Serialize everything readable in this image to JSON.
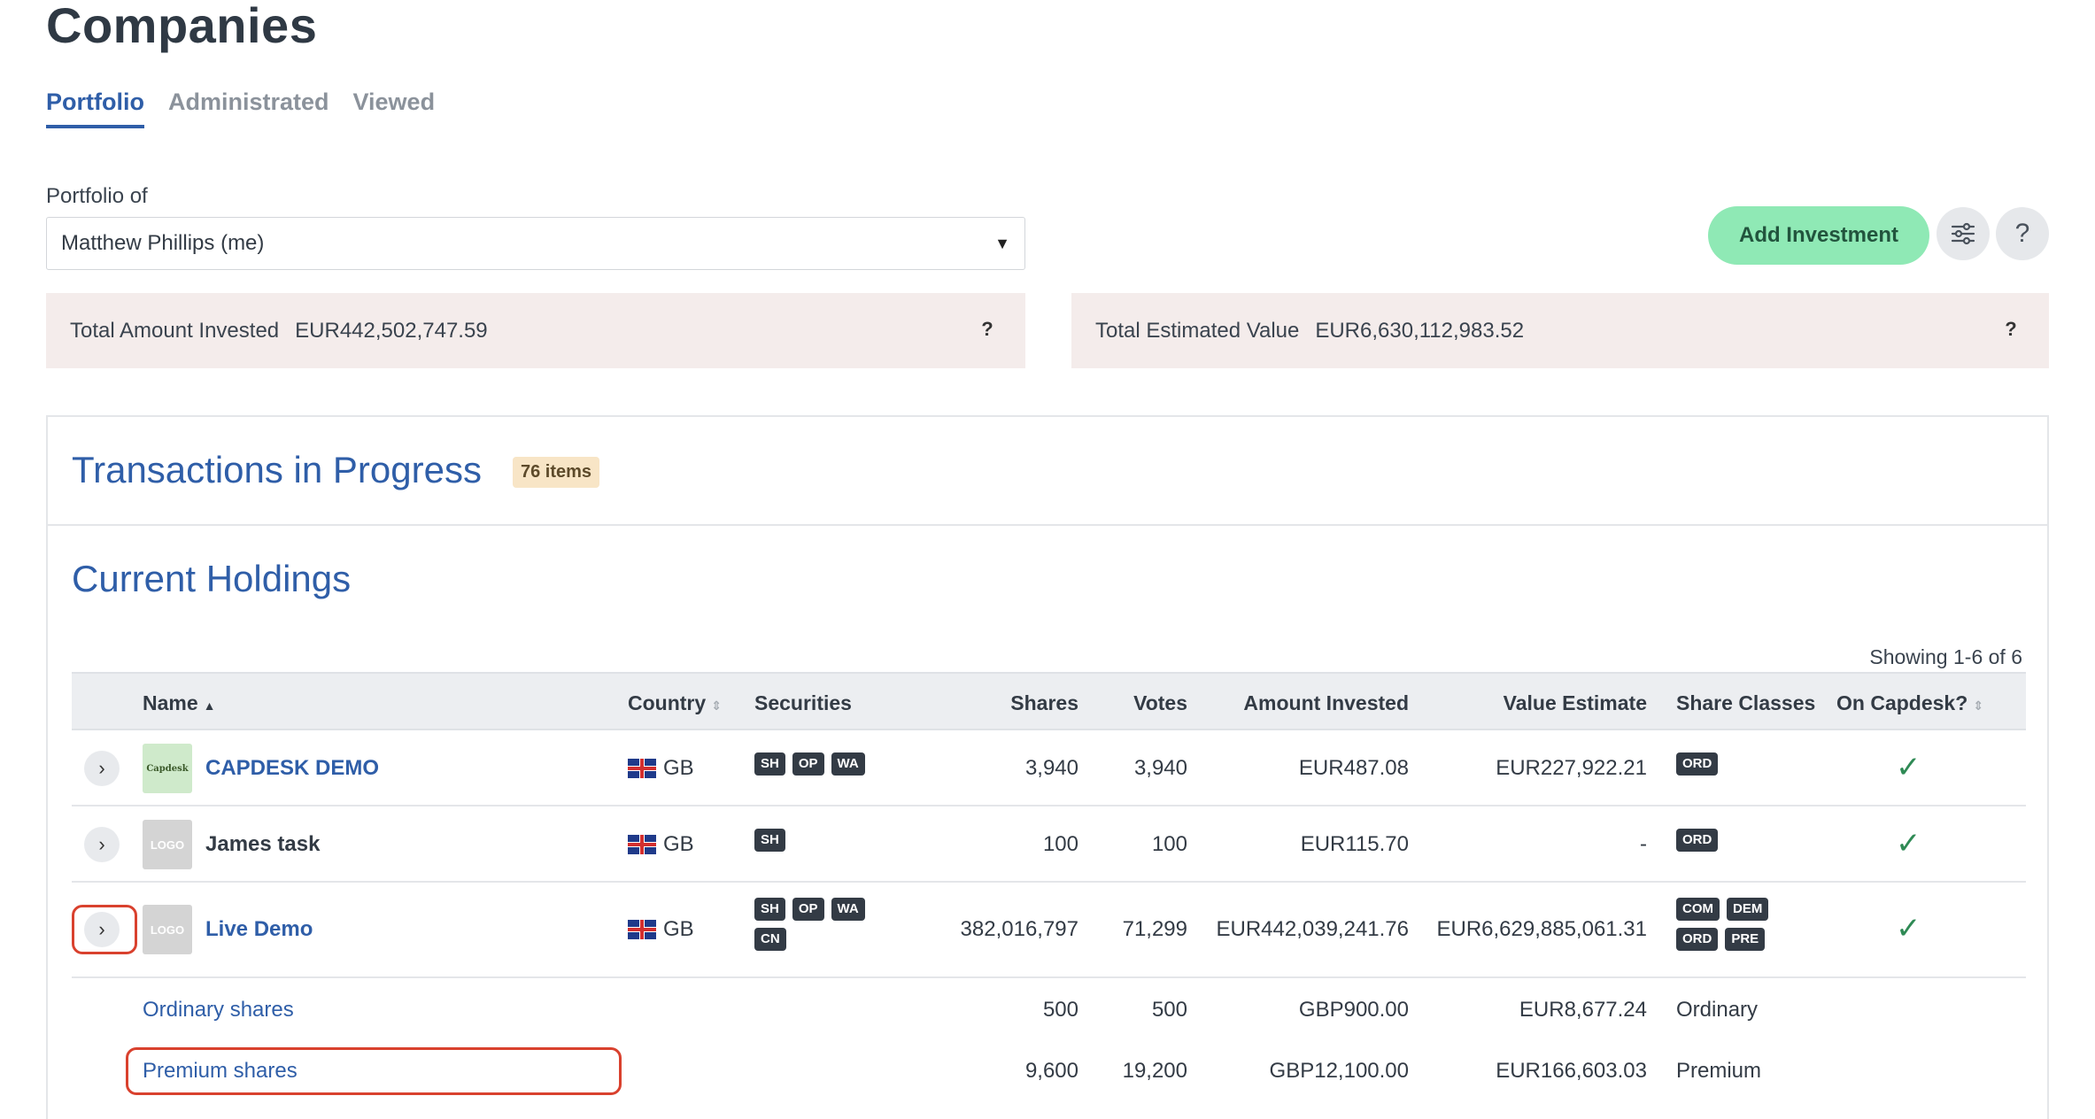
{
  "page": {
    "title": "Companies"
  },
  "tabs": [
    {
      "label": "Portfolio",
      "active": true
    },
    {
      "label": "Administrated",
      "active": false
    },
    {
      "label": "Viewed",
      "active": false
    }
  ],
  "portfolio": {
    "label": "Portfolio of",
    "selected": "Matthew Phillips (me)"
  },
  "toolbar": {
    "add_investment": "Add Investment",
    "filter_icon": "sliders-icon",
    "help_icon": "question-icon",
    "help_glyph": "?"
  },
  "summary": {
    "invested_label": "Total Amount Invested",
    "invested_value": "EUR442,502,747.59",
    "estimated_label": "Total Estimated Value",
    "estimated_value": "EUR6,630,112,983.52",
    "help_glyph": "?"
  },
  "transactions": {
    "title": "Transactions in Progress",
    "badge": "76 items"
  },
  "holdings": {
    "title": "Current Holdings",
    "showing": "Showing 1-6 of 6",
    "columns": {
      "name": "Name",
      "country": "Country",
      "securities": "Securities",
      "shares": "Shares",
      "votes": "Votes",
      "amount_invested": "Amount Invested",
      "value_estimate": "Value Estimate",
      "share_classes": "Share Classes",
      "on_capdesk": "On Capdesk?"
    },
    "rows": [
      {
        "name": "CAPDESK DEMO",
        "logo": "Capdesk",
        "country": "GB",
        "securities": [
          "SH",
          "OP",
          "WA"
        ],
        "shares": "3,940",
        "votes": "3,940",
        "amount_invested": "EUR487.08",
        "value_estimate": "EUR227,922.21",
        "share_classes": [
          "ORD"
        ],
        "on_capdesk": "✓"
      },
      {
        "name": "James task",
        "logo": "LOGO",
        "country": "GB",
        "securities": [
          "SH"
        ],
        "shares": "100",
        "votes": "100",
        "amount_invested": "EUR115.70",
        "value_estimate": "-",
        "share_classes": [
          "ORD"
        ],
        "on_capdesk": "✓"
      },
      {
        "name": "Live Demo",
        "logo": "LOGO",
        "country": "GB",
        "securities": [
          "SH",
          "OP",
          "WA",
          "CN"
        ],
        "shares": "382,016,797",
        "votes": "71,299",
        "amount_invested": "EUR442,039,241.76",
        "value_estimate": "EUR6,629,885,061.31",
        "share_classes": [
          "COM",
          "DEM",
          "ORD",
          "PRE"
        ],
        "on_capdesk": "✓"
      }
    ],
    "sub_rows": [
      {
        "name": "Ordinary shares",
        "shares": "500",
        "votes": "500",
        "amount_invested": "GBP900.00",
        "value_estimate": "EUR8,677.24",
        "share_class": "Ordinary"
      },
      {
        "name": "Premium shares",
        "shares": "9,600",
        "votes": "19,200",
        "amount_invested": "GBP12,100.00",
        "value_estimate": "EUR166,603.03",
        "share_class": "Premium"
      }
    ]
  },
  "colors": {
    "accent": "#2f5ea8",
    "add_button": "#8fe9b5",
    "highlight": "#d9412e",
    "summary_bg": "#f4eceb",
    "badge_bg": "#f8e5c6"
  }
}
